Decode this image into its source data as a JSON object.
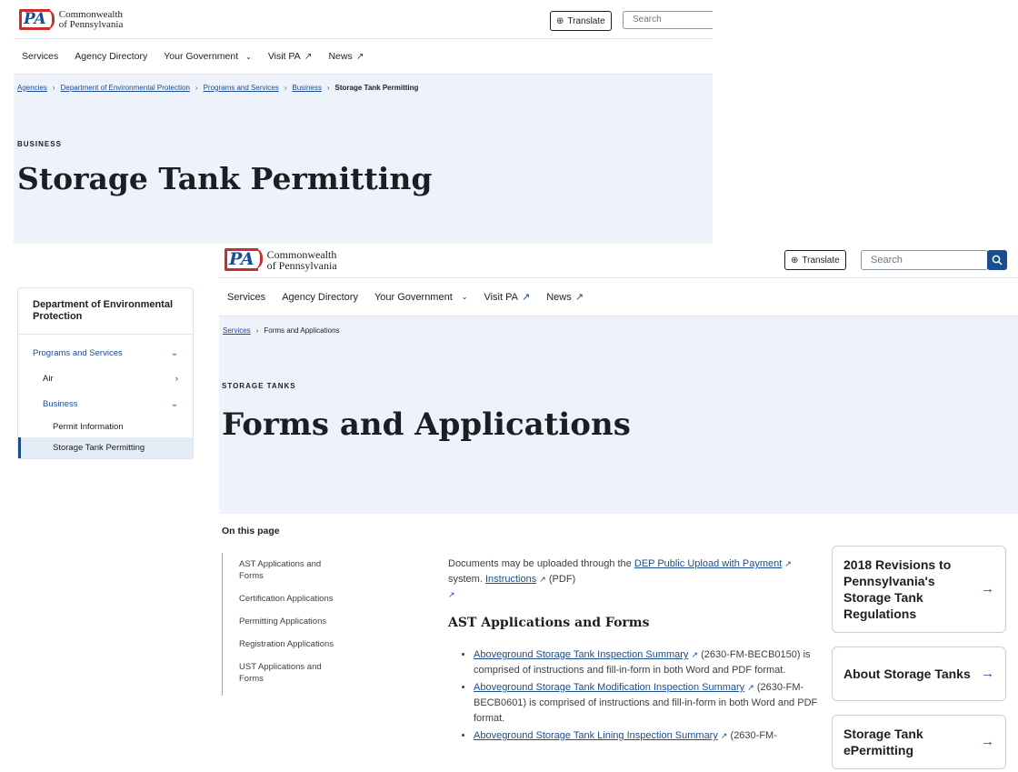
{
  "site": {
    "logo_mark": "PA",
    "logo_line1": "Commonwealth",
    "logo_line2": "of Pennsylvania",
    "translate_label": "Translate",
    "search_placeholder": "Search"
  },
  "nav": {
    "services": "Services",
    "agency_directory": "Agency Directory",
    "your_government": "Your Government",
    "visit_pa": "Visit PA",
    "news": "News"
  },
  "back_page": {
    "breadcrumbs": [
      "Agencies",
      "Department of Environmental Protection",
      "Programs and Services",
      "Business"
    ],
    "breadcrumb_current": "Storage Tank Permitting",
    "eyebrow": "BUSINESS",
    "title": "Storage Tank Permitting",
    "sidenav": {
      "heading": "Department of Environmental Protection",
      "items": [
        {
          "label": "Programs and Services"
        },
        {
          "label": "Air"
        },
        {
          "label": "Business"
        },
        {
          "label": "Permit Information"
        },
        {
          "label": "Storage Tank Permitting"
        }
      ]
    }
  },
  "front_page": {
    "breadcrumbs": [
      "Services"
    ],
    "breadcrumb_current": "Forms and Applications",
    "eyebrow": "STORAGE TANKS",
    "title": "Forms and Applications",
    "on_this_page": "On this page",
    "toc": [
      "AST Applications and Forms",
      "Certification Applications",
      "Permitting Applications",
      "Registration Applications",
      "UST Applications and Forms"
    ],
    "intro_pre": "Documents may be uploaded through the",
    "intro_link1": "DEP Public Upload with Payment",
    "intro_mid": "system.",
    "intro_link2": "Instructions",
    "intro_post": "(PDF)",
    "section_heading": "AST Applications and Forms",
    "items": [
      {
        "link": "Aboveground Storage Tank Inspection Summary",
        "text": "(2630-FM-BECB0150) is comprised of instructions and fill-in-form in both Word and PDF format."
      },
      {
        "link": "Aboveground Storage Tank Modification Inspection Summary",
        "text": "(2630-FM-BECB0601) is comprised of instructions and fill-in-form in both Word and PDF format."
      },
      {
        "link": "Aboveground Storage Tank Lining Inspection Summary",
        "text": "(2630-FM-"
      }
    ],
    "cards": [
      "2018 Revisions to Pennsylvania's Storage Tank Regulations",
      "About Storage Tanks",
      "Storage Tank ePermitting"
    ]
  },
  "colors": {
    "accent": "#1a4d8f",
    "hero_bg": "#eef3fb",
    "logo_red": "#c9302c"
  }
}
